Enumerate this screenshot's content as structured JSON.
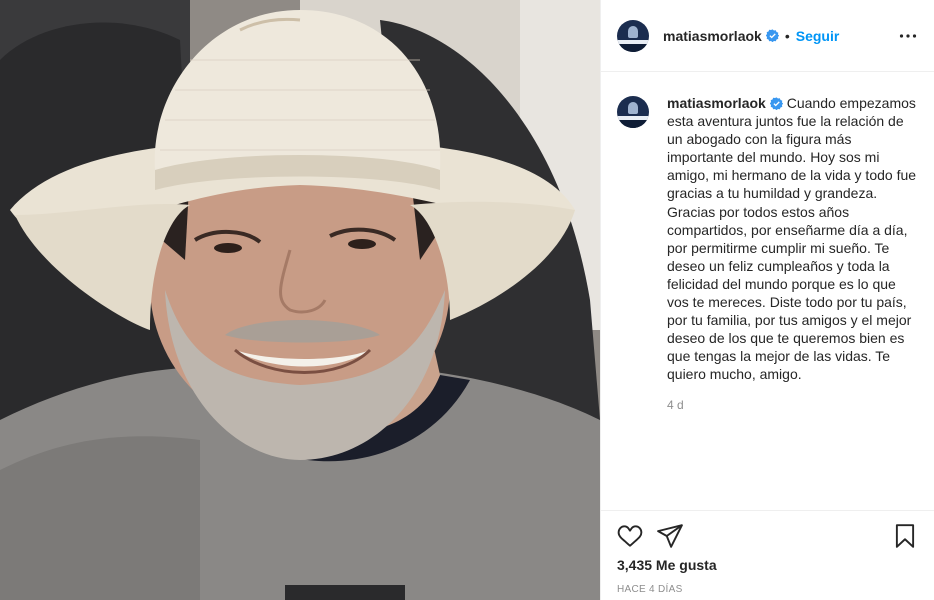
{
  "post": {
    "photo_icon": "portrait-photo",
    "header": {
      "username": "matiasmorlaok",
      "separator": "•",
      "follow_label": "Seguir",
      "more_icon": "more-options-icon"
    },
    "caption": {
      "username": "matiasmorlaok",
      "text": "Cuando empezamos esta aventura juntos fue la relación de un abogado con la figura más importante del mundo. Hoy sos mi amigo, mi hermano de la vida y todo fue gracias a tu humildad y grandeza. Gracias por todos estos años compartidos, por enseñarme día a día, por permitirme cumplir mi sueño. Te deseo un feliz cumpleaños y toda la felicidad del mundo porque es lo que vos te mereces. Diste todo por tu país, por tu familia, por tus amigos y el mejor deseo de los que te queremos bien es que tengas la mejor de las vidas. Te quiero mucho, amigo.",
      "time": "4 d"
    },
    "actions": {
      "like_icon": "heart-icon",
      "share_icon": "send-icon",
      "save_icon": "bookmark-icon",
      "likes": "3,435 Me gusta",
      "posted_ago": "HACE 4 DÍAS"
    },
    "colors": {
      "link": "#0095f6",
      "verified": "#3897f0",
      "muted": "#8e8e8e",
      "text": "#262626"
    }
  }
}
